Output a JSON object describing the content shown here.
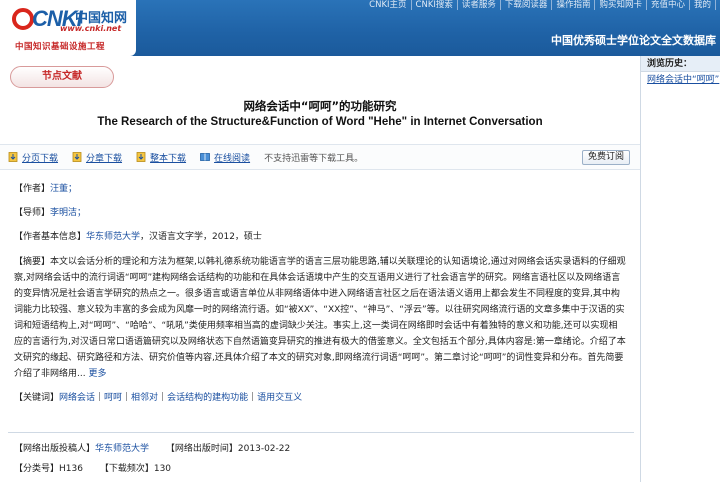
{
  "header": {
    "logo_text": "CNKI",
    "logo_zh": "中国知网",
    "logo_url": "www.cnki.net",
    "logo_sub": "中国知识基础设施工程",
    "nav": [
      "CNKI主页",
      "CNKI搜索",
      "读者服务",
      "下载阅读器",
      "操作指南",
      "购买知网卡",
      "充值中心",
      "我的"
    ],
    "title": "中国优秀硕士学位论文全文数据库"
  },
  "main": {
    "node_tab": "节点文献",
    "title_cn": "网络会话中“呵呵”的功能研究",
    "title_en": "The Research of the Structure&Function of Word \"Hehe\" in Internet Conversation",
    "toolbar": {
      "items": [
        "分页下载",
        "分章下载",
        "整本下载",
        "在线阅读"
      ],
      "note": "不支持迅雷等下载工具。",
      "free_btn": "免费订阅"
    },
    "author_label": "【作者】",
    "author": "汪董；",
    "advisor_label": "【导师】",
    "advisor": "李明洁；",
    "info_label": "【作者基本信息】",
    "info_school": "华东师范大学",
    "info_rest": "，汉语言文字学，2012，硕士",
    "abstract_label": "【摘要】",
    "abstract": "本文以会话分析的理论和方法为框架,以韩礼德系统功能语言学的语言三层功能思路,辅以关联理论的认知语境论,通过对网络会话实录语料的仔细观察,对网络会话中的流行词语“呵呵”建构网络会话结构的功能和在具体会话语境中产生的交互语用义进行了社会语言学的研究。网络言语社区以及网络语言的变异情况是社会语言学研究的热点之一。很多语言或语言单位从非网络语体中进入网络语言社区之后在语法语义语用上都会发生不同程度的变异,其中构词能力比较强、意义较为丰富的多会成为风靡一时的网络流行语。如“被XX”、“XX控”、“神马”、“浮云”等。以往研究网络流行语的文章多集中于汉语的实词和短语结构上,对“呵呵”、“哈哈”、“吼吼”类使用频率相当高的虚词缺少关注。事实上,这一类词在网络即时会话中有着独特的意义和功能,还可以实现相应的言语行为,对汉语日常口语语篇研究以及网络状态下自然语篇变异研究的推进有极大的借鉴意义。全文包括五个部分,具体内容是:第一章绪论。介绍了本文研究的缘起、研究路径和方法、研究价值等内容,还具体介绍了本文的研究对象,即网络流行词语“呵呵”。第二章讨论“呵呵”的词性变异和分布。首先简要介绍了非网络用...",
    "more": "更多",
    "keywords_label": "【关键词】",
    "keywords": [
      "网络会话",
      "呵呵",
      "相邻对",
      "会话结构的建构功能",
      "语用交互义"
    ],
    "publisher_label": "【网络出版投稿人】",
    "publisher": "华东师范大学",
    "pubtime_label": "【网络出版时间】",
    "pubtime": "2013-02-22",
    "class_label": "【分类号】",
    "class_no": "H136",
    "downloads_label": "【下载频次】",
    "downloads": "130"
  },
  "sidebar": {
    "head": "浏览历史：",
    "items": [
      "网络会话中“呵呵”"
    ]
  }
}
